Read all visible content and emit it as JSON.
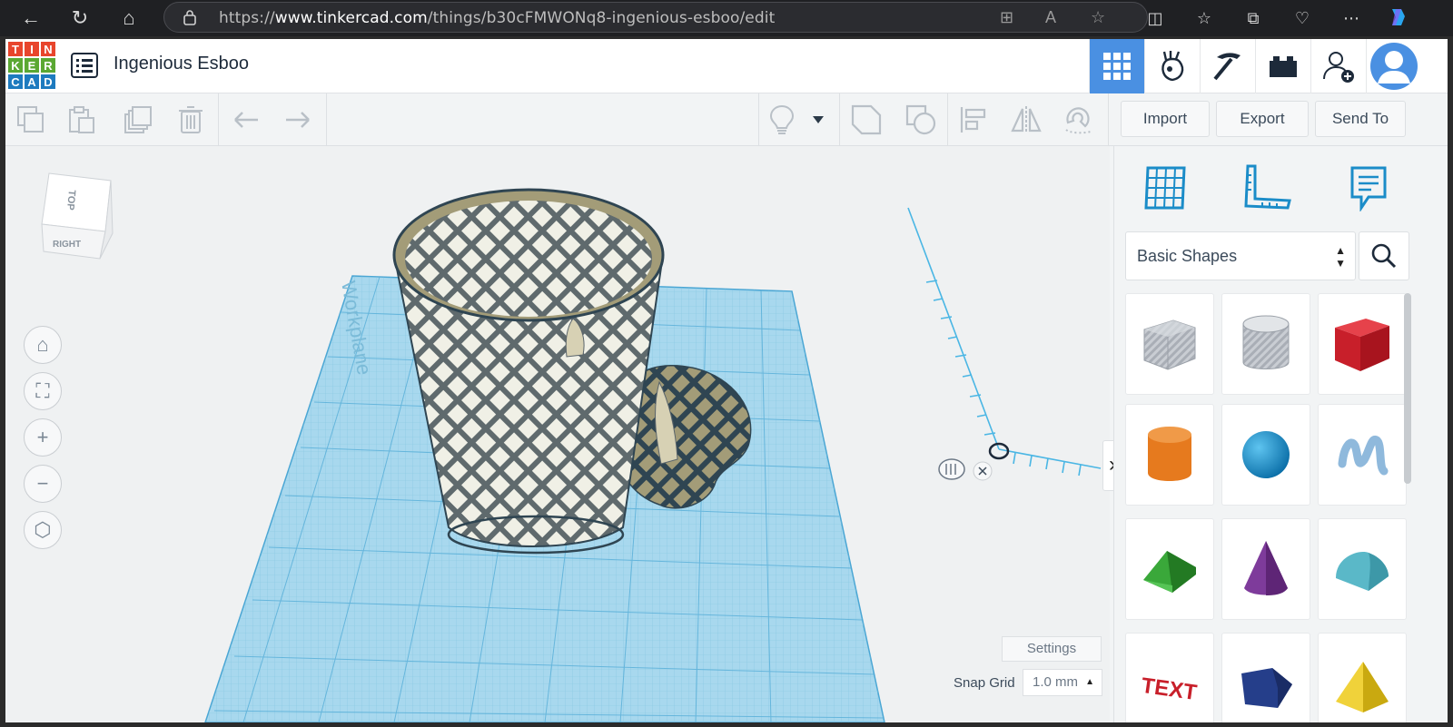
{
  "browser": {
    "url_prefix": "https://",
    "url_domain": "www.tinkercad.com",
    "url_path": "/things/b30cFMWONq8-ingenious-esboo/edit"
  },
  "app": {
    "logo_letters": [
      "T",
      "I",
      "N",
      "K",
      "E",
      "R",
      "C",
      "A",
      "D"
    ],
    "logo_colors": [
      "#e8452c",
      "#e8452c",
      "#e8452c",
      "#5ba833",
      "#5ba833",
      "#5ba833",
      "#1e7bbf",
      "#1e7bbf",
      "#1e7bbf"
    ],
    "title": "Ingenious Esboo",
    "accent": "#4a90e2",
    "header_icons": [
      "3d-design-grid-icon",
      "codeblocks-icon",
      "minecraft-pickaxe-icon",
      "brick-icon",
      "invite-user-icon",
      "avatar-icon"
    ]
  },
  "toolbar": {
    "icons": [
      "copy-icon",
      "paste-icon",
      "duplicate-icon",
      "delete-icon",
      "undo-icon",
      "redo-icon",
      "lightbulb-icon",
      "dropdown-arrow-icon",
      "group-icon",
      "ungroup-icon",
      "align-icon",
      "mirror-icon",
      "magnet-icon"
    ],
    "import_label": "Import",
    "export_label": "Export",
    "send_to_label": "Send To"
  },
  "viewport": {
    "view_cube_top": "TOP",
    "view_cube_right": "RIGHT",
    "workplane_label": "Workplane",
    "controls": [
      "home-icon",
      "fit-all-icon",
      "zoom-in-icon",
      "zoom-out-icon",
      "perspective-icon"
    ],
    "settings_label": "Settings",
    "snap_grid_label": "Snap Grid",
    "snap_grid_value": "1.0 mm"
  },
  "panel": {
    "tabs": [
      "workplane-grid-icon",
      "ruler-icon",
      "notes-icon"
    ],
    "category": "Basic Shapes",
    "shapes": [
      {
        "name": "Box Hole",
        "color": "#b9bec6"
      },
      {
        "name": "Cylinder Hole",
        "color": "#c4c8ce"
      },
      {
        "name": "Box",
        "color": "#d4202a"
      },
      {
        "name": "Cylinder",
        "color": "#e67a1e"
      },
      {
        "name": "Sphere",
        "color": "#1893d3"
      },
      {
        "name": "Scribble",
        "color": "#8fb9dc"
      },
      {
        "name": "Roof",
        "color": "#3aa83a"
      },
      {
        "name": "Cone",
        "color": "#7e3b9b"
      },
      {
        "name": "Round Roof",
        "color": "#5ab8c8"
      },
      {
        "name": "Text",
        "color": "#c81f2a"
      },
      {
        "name": "Polygon",
        "color": "#253e8a"
      },
      {
        "name": "Pyramid",
        "color": "#e8c51a"
      }
    ]
  }
}
